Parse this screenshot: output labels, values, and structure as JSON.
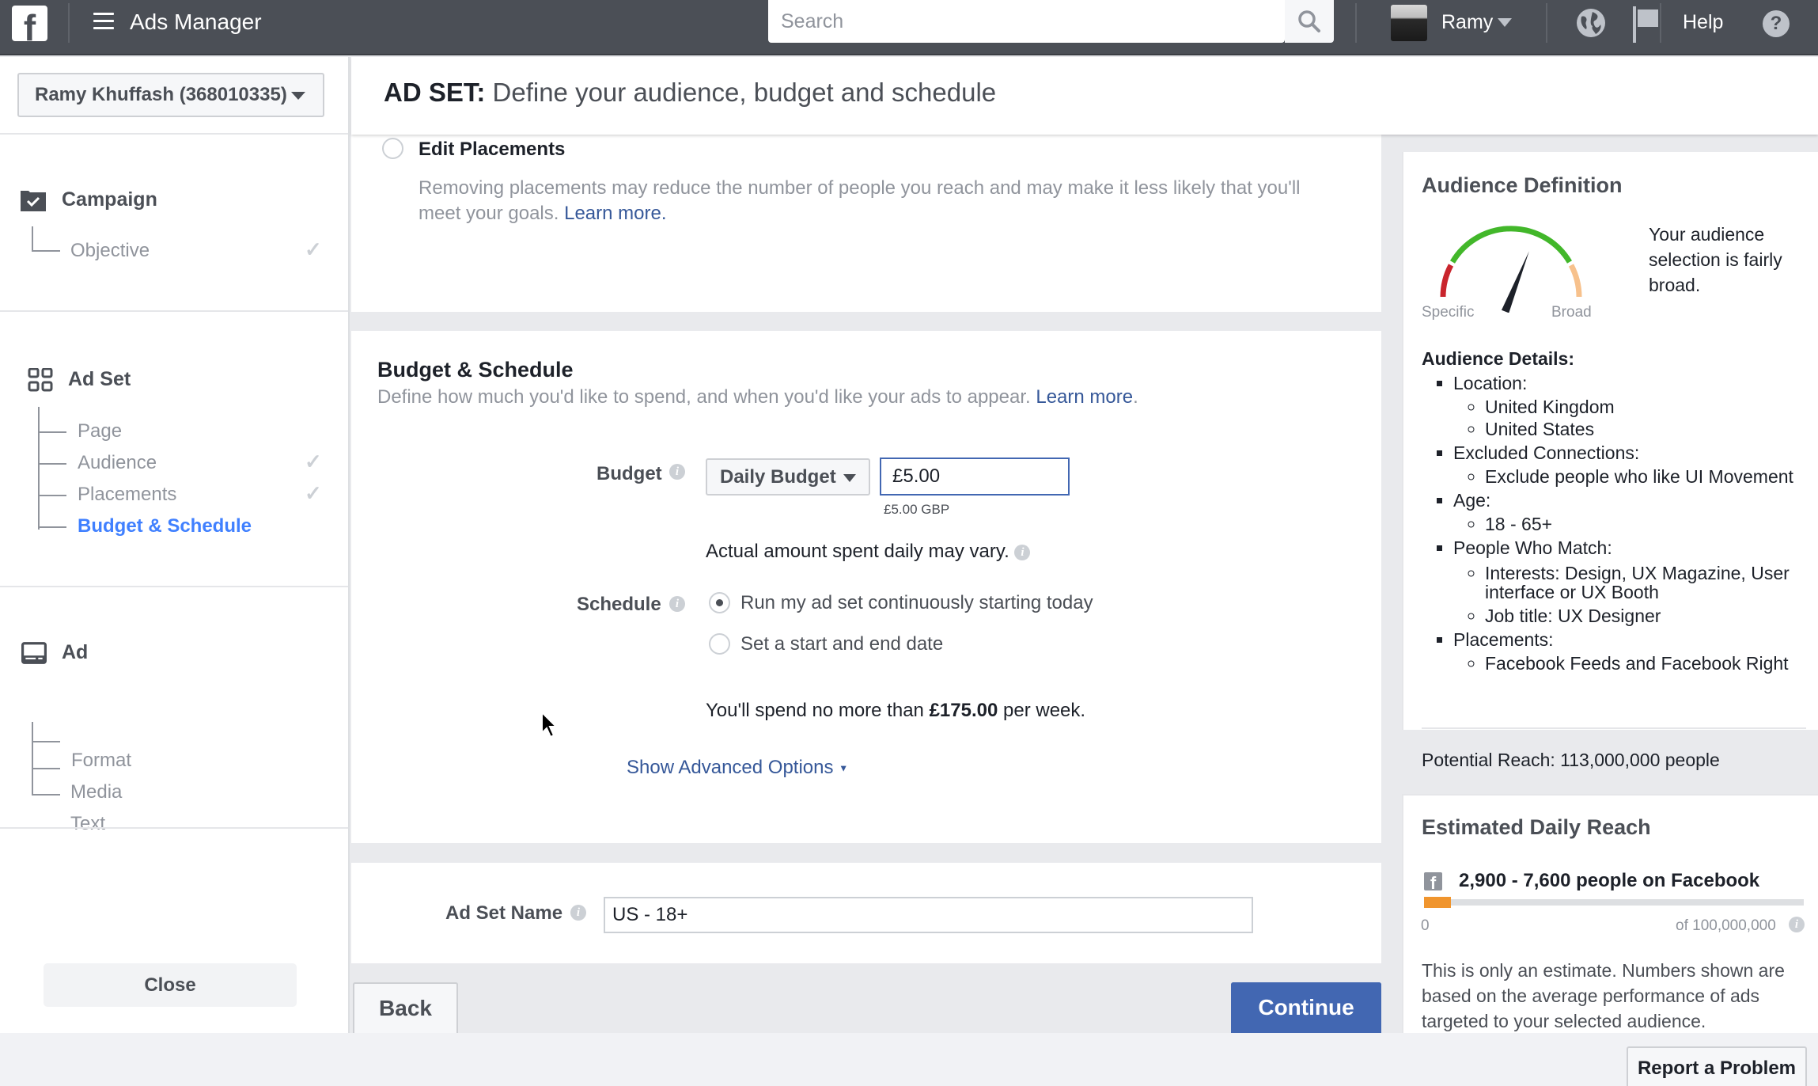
{
  "topbar": {
    "app_title": "Ads Manager",
    "search_placeholder": "Search",
    "username": "Ramy",
    "help_label": "Help"
  },
  "sidebar": {
    "account": "Ramy Khuffash (368010335)",
    "sections": [
      {
        "title": "Campaign",
        "items": [
          {
            "label": "Objective",
            "completed": true
          }
        ]
      },
      {
        "title": "Ad Set",
        "items": [
          {
            "label": "Page",
            "completed": false
          },
          {
            "label": "Audience",
            "completed": true
          },
          {
            "label": "Placements",
            "completed": true
          },
          {
            "label": "Budget & Schedule",
            "completed": false,
            "active": true
          }
        ]
      },
      {
        "title": "Ad",
        "items": [
          {
            "label": "Format"
          },
          {
            "label": "Media"
          },
          {
            "label": "Text"
          }
        ]
      }
    ],
    "close_label": "Close"
  },
  "header": {
    "prefix": "AD SET:",
    "title": "Define your audience, budget and schedule"
  },
  "placements": {
    "option_label": "Edit Placements",
    "description": "Removing placements may reduce the number of people you reach and may make it less likely that you'll meet your goals.",
    "learn_more": "Learn more."
  },
  "budget_schedule": {
    "title": "Budget & Schedule",
    "description": "Define how much you'd like to spend, and when you'd like your ads to appear.",
    "learn_more": "Learn more",
    "budget_label": "Budget",
    "budget_type": "Daily Budget",
    "budget_value": "£5.00",
    "budget_currency_note": "£5.00 GBP",
    "budget_note": "Actual amount spent daily may vary.",
    "schedule_label": "Schedule",
    "schedule_options": [
      {
        "label": "Run my ad set continuously starting today",
        "selected": true
      },
      {
        "label": "Set a start and end date",
        "selected": false
      }
    ],
    "weekly_prefix": "You'll spend no more than",
    "weekly_amount": "£175.00",
    "weekly_suffix": "per week.",
    "advanced_options": "Show Advanced Options"
  },
  "adset_name": {
    "label": "Ad Set Name",
    "value": "US - 18+"
  },
  "footer": {
    "back_label": "Back",
    "continue_label": "Continue",
    "report_label": "Report a Problem"
  },
  "audience_definition": {
    "title": "Audience Definition",
    "gauge_left": "Specific",
    "gauge_right": "Broad",
    "gauge_level": 0.62,
    "summary": "Your audience selection is fairly broad.",
    "details_title": "Audience Details:",
    "details": [
      {
        "label": "Location:",
        "values": [
          "United Kingdom",
          "United States"
        ]
      },
      {
        "label": "Excluded Connections:",
        "values": [
          "Exclude people who like UI Movement"
        ]
      },
      {
        "label": "Age:",
        "values": [
          "18 - 65+"
        ]
      },
      {
        "label": "People Who Match:",
        "values": [
          "Interests: Design, UX Magazine, User interface or UX Booth",
          "Job title: UX Designer"
        ]
      },
      {
        "label": "Placements:",
        "values": [
          "Facebook Feeds and Facebook Right"
        ]
      }
    ],
    "potential_reach": "Potential Reach: 113,000,000 people"
  },
  "daily_reach": {
    "title": "Estimated Daily Reach",
    "range": "2,900 - 7,600 people on Facebook",
    "bar_fill_percent": 7,
    "min_label": "0",
    "max_label": "of 100,000,000",
    "disclaimer": "This is only an estimate. Numbers shown are based on the average performance of ads targeted to your selected audience."
  }
}
